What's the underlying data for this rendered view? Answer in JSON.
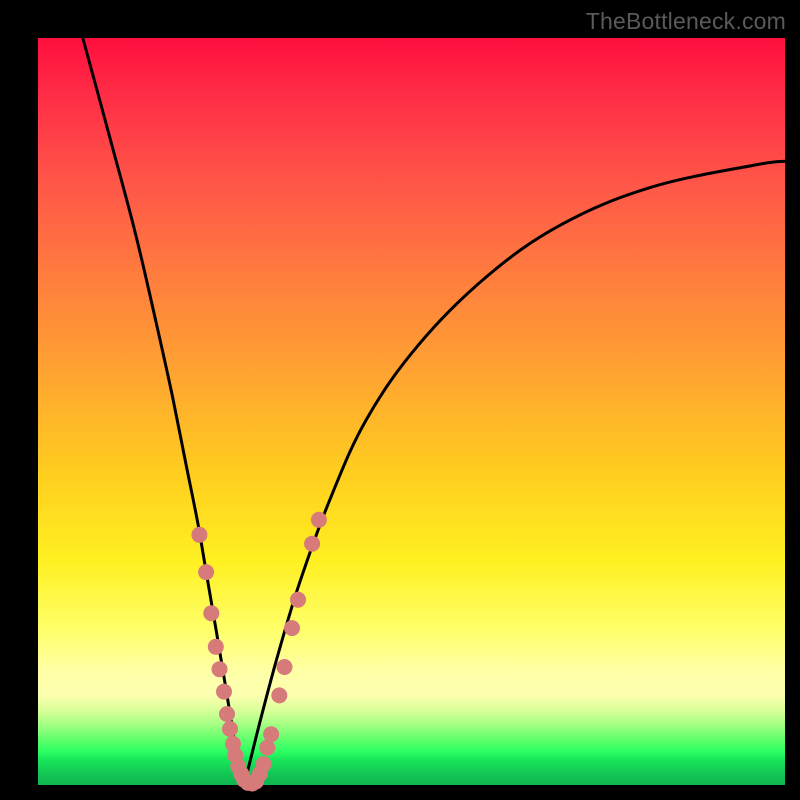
{
  "watermark": "TheBottleneck.com",
  "chart_data": {
    "type": "line",
    "title": "",
    "xlabel": "",
    "ylabel": "",
    "xlim": [
      0,
      1
    ],
    "ylim": [
      0,
      1
    ],
    "grid": false,
    "legend": false,
    "series": [
      {
        "name": "bottleneck-v-curve-left",
        "x": [
          0.06,
          0.098,
          0.13,
          0.158,
          0.18,
          0.198,
          0.214,
          0.226,
          0.238,
          0.248,
          0.258,
          0.266,
          0.276
        ],
        "y": [
          1.0,
          0.86,
          0.74,
          0.62,
          0.52,
          0.43,
          0.35,
          0.28,
          0.21,
          0.15,
          0.09,
          0.04,
          0.0
        ],
        "color": "#000000"
      },
      {
        "name": "bottleneck-v-curve-right",
        "x": [
          0.276,
          0.296,
          0.32,
          0.35,
          0.39,
          0.44,
          0.51,
          0.6,
          0.7,
          0.82,
          0.96,
          1.0
        ],
        "y": [
          0.0,
          0.08,
          0.17,
          0.27,
          0.38,
          0.49,
          0.59,
          0.68,
          0.75,
          0.8,
          0.83,
          0.835
        ],
        "color": "#000000"
      }
    ],
    "markers": [
      {
        "name": "left-branch-dots",
        "color": "#d67a7a",
        "points": [
          [
            0.216,
            0.335
          ],
          [
            0.225,
            0.285
          ],
          [
            0.232,
            0.23
          ],
          [
            0.238,
            0.185
          ],
          [
            0.243,
            0.155
          ],
          [
            0.249,
            0.125
          ],
          [
            0.253,
            0.095
          ],
          [
            0.257,
            0.075
          ],
          [
            0.261,
            0.055
          ],
          [
            0.264,
            0.04
          ],
          [
            0.268,
            0.025
          ],
          [
            0.272,
            0.015
          ],
          [
            0.276,
            0.007
          ],
          [
            0.281,
            0.003
          ],
          [
            0.287,
            0.002
          ]
        ]
      },
      {
        "name": "right-branch-dots",
        "color": "#d67a7a",
        "points": [
          [
            0.292,
            0.005
          ],
          [
            0.297,
            0.015
          ],
          [
            0.302,
            0.028
          ],
          [
            0.307,
            0.05
          ],
          [
            0.312,
            0.068
          ],
          [
            0.323,
            0.12
          ],
          [
            0.33,
            0.158
          ],
          [
            0.34,
            0.21
          ],
          [
            0.348,
            0.248
          ],
          [
            0.367,
            0.323
          ],
          [
            0.376,
            0.355
          ]
        ]
      }
    ],
    "background_gradient": {
      "orientation": "vertical",
      "stops": [
        {
          "pos": 0.0,
          "color": "#ff0f3f"
        },
        {
          "pos": 0.45,
          "color": "#ffa431"
        },
        {
          "pos": 0.7,
          "color": "#fff021"
        },
        {
          "pos": 0.88,
          "color": "#fbffae"
        },
        {
          "pos": 0.95,
          "color": "#2cff63"
        },
        {
          "pos": 1.0,
          "color": "#10b64f"
        }
      ]
    }
  }
}
